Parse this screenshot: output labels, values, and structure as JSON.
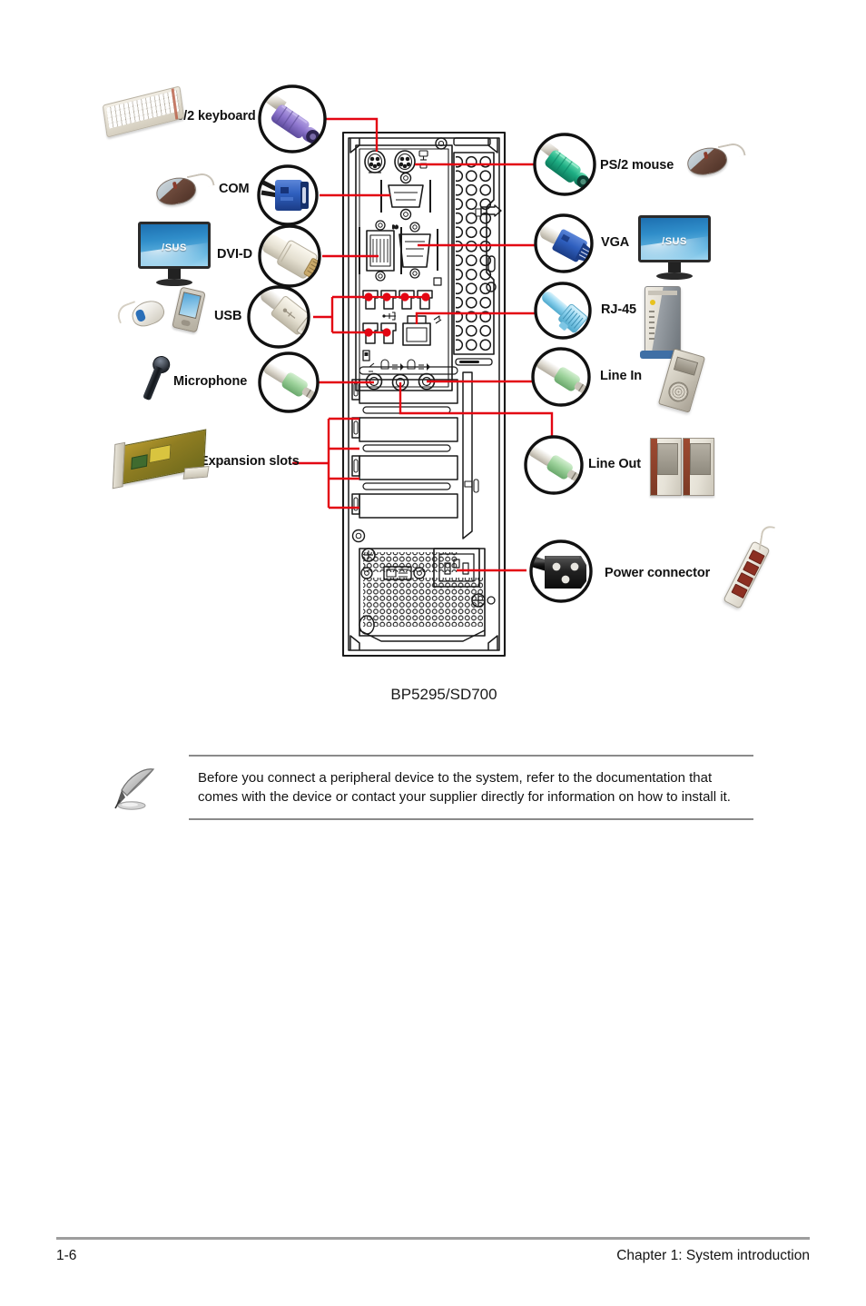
{
  "page": {
    "model_caption": "BP5295/SD700",
    "note_text": "Before you connect a peripheral device to the system, refer to the documentation that comes with the device or contact your supplier directly for information on how to install it.",
    "note_icon": "pencil-note-icon",
    "accent_color": "#e30613",
    "footer": {
      "page_number": "1-6",
      "chapter_title": "Chapter 1: System introduction"
    }
  },
  "diagram": {
    "title": "rear-panel-connection-diagram",
    "chassis": {
      "name": "desktop-tower-rear-panel",
      "expansion_slot_count": 4,
      "usb_port_count": 6,
      "audio_jack_count": 3
    },
    "left_callouts": [
      {
        "id": "ps2-keyboard",
        "label": "PS/2 keyboard",
        "connector_icon": "ps2-keyboard-connector-icon",
        "connector_color": "#8b6fc6",
        "device_icon": "keyboard-icon"
      },
      {
        "id": "com",
        "label": "COM",
        "connector_icon": "serial-com-connector-icon",
        "connector_color": "#2f5fbe",
        "device_icon": "mouse-icon"
      },
      {
        "id": "dvi-d",
        "label": "DVI-D",
        "connector_icon": "dvi-d-connector-icon",
        "connector_color": "#e8e2d3",
        "device_icon": "lcd-monitor-icon"
      },
      {
        "id": "usb",
        "label": "USB",
        "connector_icon": "usb-connector-icon",
        "connector_color": "#dcd9d0",
        "device_icon": "usb-mouse-and-pda-icon"
      },
      {
        "id": "microphone",
        "label": "Microphone",
        "connector_icon": "audio-jack-connector-icon",
        "connector_color": "#9ed39c",
        "device_icon": "microphone-icon"
      },
      {
        "id": "expansion-slots",
        "label": "Expansion slots",
        "connector_icon": "none",
        "connector_color": "",
        "device_icon": "expansion-card-icon"
      }
    ],
    "right_callouts": [
      {
        "id": "ps2-mouse",
        "label": "PS/2 mouse",
        "connector_icon": "ps2-mouse-connector-icon",
        "connector_color": "#1eae84",
        "device_icon": "mouse-icon"
      },
      {
        "id": "vga",
        "label": "VGA",
        "connector_icon": "vga-connector-icon",
        "connector_color": "#2f5fbe",
        "device_icon": "lcd-monitor-icon"
      },
      {
        "id": "rj-45",
        "label": "RJ-45",
        "connector_icon": "rj45-connector-icon",
        "connector_color": "#8fd3ef",
        "device_icon": "network-device-icon"
      },
      {
        "id": "line-in",
        "label": "Line In",
        "connector_icon": "audio-jack-connector-icon",
        "connector_color": "#9ed39c",
        "device_icon": "cassette-recorder-icon"
      },
      {
        "id": "line-out",
        "label": "Line Out",
        "connector_icon": "audio-jack-connector-icon",
        "connector_color": "#9ed39c",
        "device_icon": "speakers-icon"
      },
      {
        "id": "power-connector",
        "label": "Power connector",
        "connector_icon": "iec-power-connector-icon",
        "connector_color": "#1c1c1c",
        "device_icon": "power-strip-icon"
      }
    ]
  }
}
